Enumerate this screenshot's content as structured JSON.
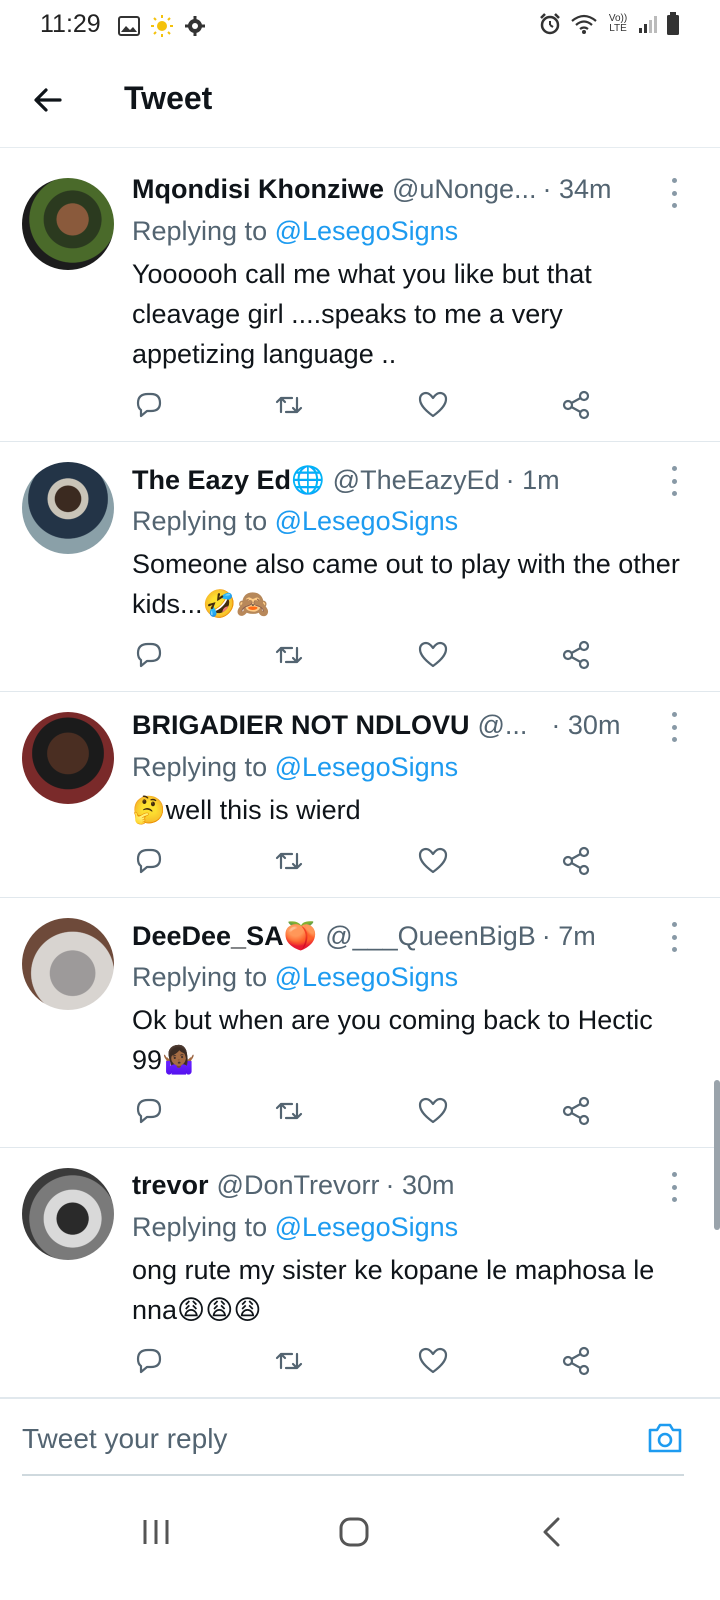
{
  "status_bar": {
    "time": "11:29",
    "left_icons": [
      "image-icon",
      "sun-icon",
      "gear-icon"
    ],
    "right_icons": [
      "alarm-icon",
      "wifi-icon",
      "volte-icon",
      "signal-icon",
      "battery-icon"
    ],
    "volte_label": "Vo)) LTE"
  },
  "header": {
    "title": "Tweet"
  },
  "tweets": [
    {
      "name": "Mqondisi Khonziwe",
      "badge": "",
      "handle": "@uNonge...",
      "time": "· 34m",
      "reply_prefix": "Replying to ",
      "reply_to": "@LesegoSigns",
      "text": "Yoooooh call me what you like but that cleavage girl ....speaks to me a very appetizing language .."
    },
    {
      "name": "The Eazy Ed",
      "badge": "🌐",
      "handle": "@TheEazyEd",
      "time": "· 1m",
      "reply_prefix": "Replying to ",
      "reply_to": "@LesegoSigns",
      "text": "Someone also came out to play with the other kids...🤣🙈"
    },
    {
      "name": "BRIGADIER NOT NDLOVU",
      "badge": "",
      "handle": "@...",
      "time": "· 30m",
      "reply_prefix": "Replying to ",
      "reply_to": "@LesegoSigns",
      "text": "🤔well this is wierd"
    },
    {
      "name": "DeeDee_SA",
      "badge": "🍑",
      "handle": "@___QueenBigB",
      "time": "· 7m",
      "reply_prefix": "Replying to ",
      "reply_to": "@LesegoSigns",
      "text": "Ok but when are you coming back to Hectic 99🤷🏾‍♀️"
    },
    {
      "name": "trevor",
      "badge": "",
      "handle": "@DonTrevorr",
      "time": "· 30m",
      "reply_prefix": "Replying to ",
      "reply_to": "@LesegoSigns",
      "text": "ong rute my sister ke kopane le maphosa le nna😩😩😩"
    }
  ],
  "reply_bar": {
    "placeholder": "Tweet your reply"
  },
  "colors": {
    "accent": "#1d9bf0",
    "secondary_text": "#536471",
    "icon_gray": "#536471",
    "divider": "#e1e8ed"
  }
}
